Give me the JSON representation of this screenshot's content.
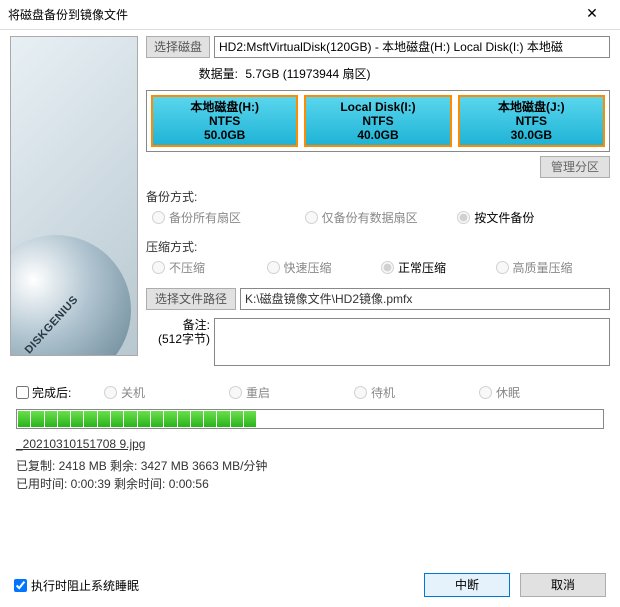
{
  "window": {
    "title": "将磁盘备份到镜像文件"
  },
  "sidebar": {
    "brand": "DISKGENIUS"
  },
  "disk": {
    "select_btn": "选择磁盘",
    "value": "HD2:MsftVirtualDisk(120GB) - 本地磁盘(H:) Local Disk(I:) 本地磁",
    "data_label": "数据量:",
    "data_value": "5.7GB (11973944 扇区)"
  },
  "partitions": [
    {
      "name": "本地磁盘(H:)",
      "fs": "NTFS",
      "size": "50.0GB"
    },
    {
      "name": "Local Disk(I:)",
      "fs": "NTFS",
      "size": "40.0GB"
    },
    {
      "name": "本地磁盘(J:)",
      "fs": "NTFS",
      "size": "30.0GB"
    }
  ],
  "manage_btn": "管理分区",
  "backup": {
    "label": "备份方式:",
    "opts": [
      "备份所有扇区",
      "仅备份有数据扇区",
      "按文件备份"
    ],
    "selected": 2
  },
  "compress": {
    "label": "压缩方式:",
    "opts": [
      "不压缩",
      "快速压缩",
      "正常压缩",
      "高质量压缩"
    ],
    "selected": 2
  },
  "path": {
    "btn": "选择文件路径",
    "value": "K:\\磁盘镜像文件\\HD2镜像.pmfx"
  },
  "remark": {
    "label": "备注:",
    "sublabel": "(512字节)"
  },
  "after": {
    "chk_label": "完成后:",
    "opts": [
      "关机",
      "重启",
      "待机",
      "休眠"
    ]
  },
  "status": {
    "file": "_20210310151708 9.jpg",
    "line1": "已复制:   2418 MB  剩余:   3427 MB  3663 MB/分钟",
    "line2": "已用时间:  0:00:39  剩余时间:  0:00:56",
    "progress_pct": 41
  },
  "footer": {
    "sleep_chk": "执行时阻止系统睡眠",
    "abort": "中断",
    "cancel": "取消"
  }
}
